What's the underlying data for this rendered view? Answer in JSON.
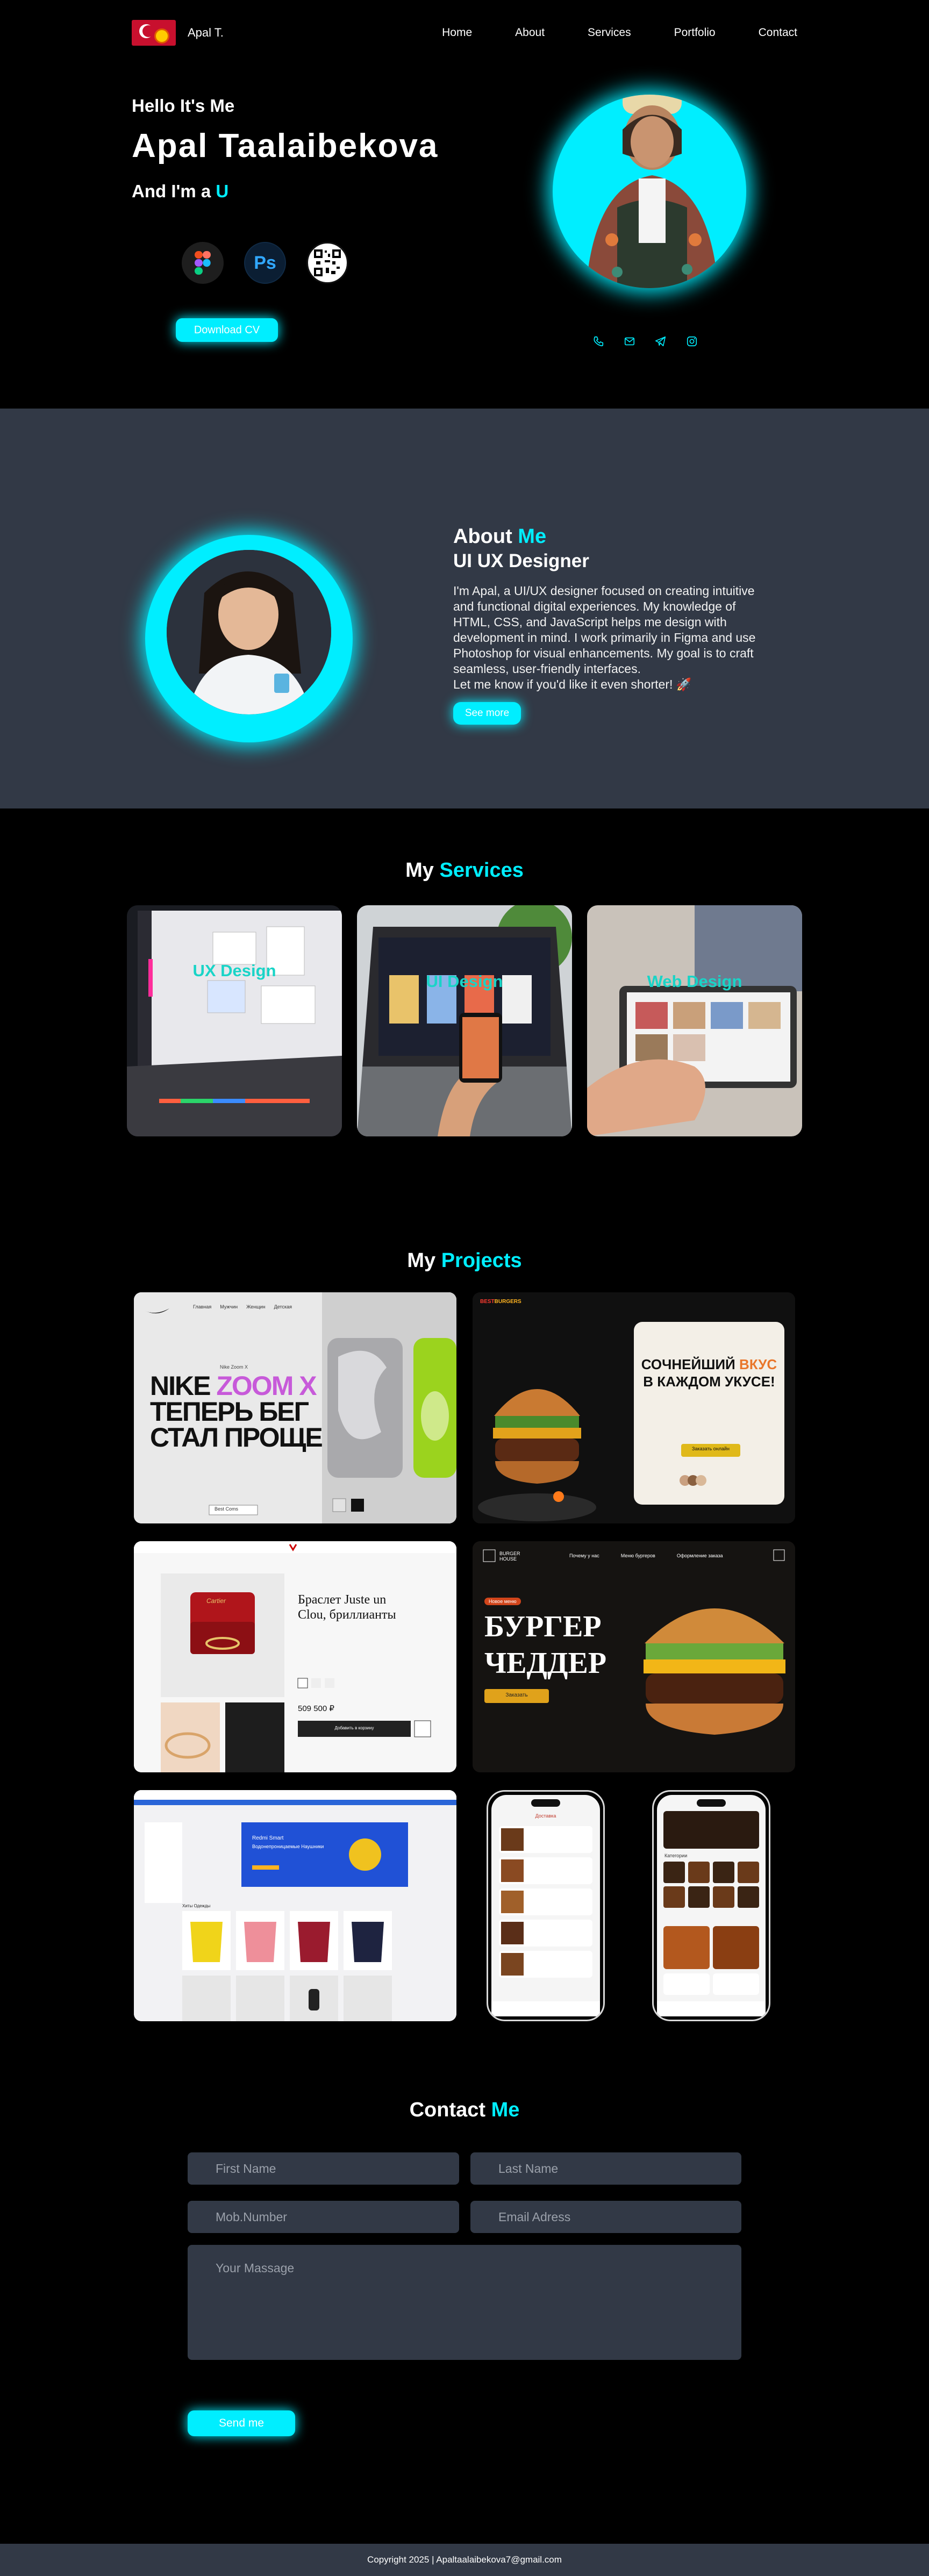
{
  "nav": {
    "logo_text": "Apal T.",
    "links": [
      "Home",
      "About",
      "Services",
      "Portfolio",
      "Contact"
    ]
  },
  "hero": {
    "greeting": "Hello It's Me",
    "name": "Apal Taalaibekova",
    "iam_prefix": "And I'm a",
    "iam_highlight": "U",
    "tools": [
      "figma-icon",
      "photoshop-icon",
      "qr-code-icon"
    ],
    "tool_ps_text": "Ps",
    "download_label": "Download CV",
    "socials": [
      "phone-icon",
      "email-icon",
      "telegram-icon",
      "instagram-icon"
    ]
  },
  "about": {
    "title_prefix": "About",
    "title_highlight": "Me",
    "subtitle": "UI UX Designer",
    "body": "I'm Apal, a UI/UX designer focused on creating intuitive and functional digital experiences. My knowledge of HTML, CSS, and JavaScript helps me design with development in mind. I work primarily in Figma and use Photoshop for visual enhancements. My goal is to craft seamless, user-friendly interfaces.",
    "body_end": "Let me know if you'd like it even shorter! 🚀",
    "button_label": "See more"
  },
  "services": {
    "title_prefix": "My",
    "title_highlight": "Services",
    "cards": [
      "UX Design",
      "UI Design",
      "Web Design"
    ]
  },
  "projects": {
    "title_prefix": "My",
    "title_highlight": "Projects",
    "nike": {
      "line1a": "NIKE",
      "line1b": "ZOOM X",
      "line2": "ТЕПЕРЬ БЕГ",
      "line3": "СТАЛ ПРОЩЕ",
      "nav": [
        "Главная",
        "Мужчин",
        "Женщин",
        "Детская"
      ],
      "tag": "Nike Zoom X",
      "price": "Best Coms"
    },
    "burger1": {
      "logo_a": "BEST",
      "logo_b": "BURGERS",
      "line1": "СОЧНЕЙШИЙ",
      "line1b": "ВКУС",
      "line2": "В КАЖДОМ УКУСЕ!",
      "cta": "Заказать онлайн"
    },
    "cartier": {
      "title": "Браслет Juste un Clou, бриллианты",
      "price": "509 500 ₽",
      "cta": "Добавить в корзину",
      "brand": "Cartier"
    },
    "burger2": {
      "logo": "BURGER HOUSE",
      "nav": [
        "Почему у нас",
        "Меню бургеров",
        "Оформление заказа"
      ],
      "badge": "Новое меню",
      "line1": "БУРГЕР",
      "line2": "ЧЕДДЕР",
      "cta": "Заказать"
    },
    "shop": {
      "banner_title": "Redmi Smart",
      "banner_sub": "Водонепроницаемые Наушники",
      "section": "Хиты Одежды"
    },
    "phone1": {
      "header": "Доставка"
    },
    "phone2": {
      "header": "Категории"
    }
  },
  "contact": {
    "title_prefix": "Contact",
    "title_highlight": "Me",
    "placeholders": {
      "first_name": "First Name",
      "last_name": "Last Name",
      "mobile": "Mob.Number",
      "email": "Email Adress",
      "message": "Your Massage"
    },
    "button_label": "Send me"
  },
  "footer": {
    "text": "Copyright  2025 | Apaltaalaibekova7@gmail.com"
  },
  "colors": {
    "accent": "#00eeff",
    "bg_dark": "#000000",
    "bg_panel": "#323946"
  }
}
